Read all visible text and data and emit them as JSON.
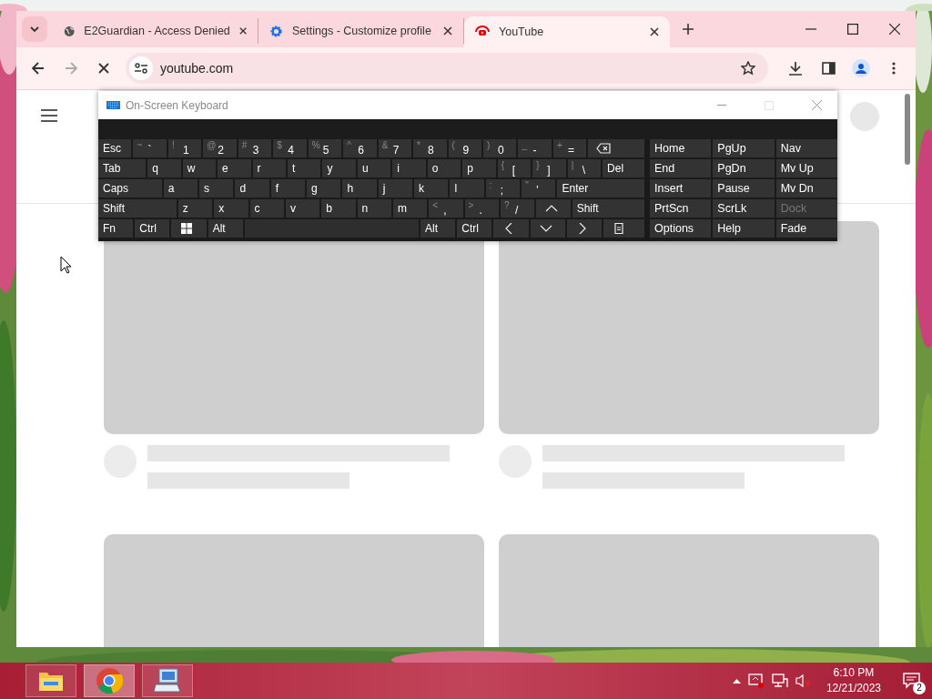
{
  "browser": {
    "tabs": [
      {
        "title": "E2Guardian - Access Denied",
        "selected": false,
        "kind": "globe"
      },
      {
        "title": "Settings - Customize profile",
        "selected": false,
        "kind": "gear"
      },
      {
        "title": "YouTube",
        "selected": true,
        "kind": "video"
      }
    ],
    "back": {
      "disabled": false
    },
    "forward": {
      "disabled": true
    },
    "loading": true,
    "address": "youtube.com"
  },
  "page": {
    "cards": [
      {
        "kind": "placeholder"
      },
      {
        "kind": "placeholder"
      },
      {
        "kind": "thumbnail"
      },
      {
        "kind": "thumbnail"
      }
    ]
  },
  "keyboard": {
    "title": "On-Screen Keyboard",
    "rows": [
      [
        {
          "label": "Esc"
        },
        {
          "shift": "~",
          "label": "`"
        },
        {
          "shift": "!",
          "label": "1"
        },
        {
          "shift": "@",
          "label": "2"
        },
        {
          "shift": "#",
          "label": "3"
        },
        {
          "shift": "$",
          "label": "4"
        },
        {
          "shift": "%",
          "label": "5"
        },
        {
          "shift": "^",
          "label": "6"
        },
        {
          "shift": "&",
          "label": "7"
        },
        {
          "shift": "*",
          "label": "8"
        },
        {
          "shift": "(",
          "label": "9"
        },
        {
          "shift": ")",
          "label": "0"
        },
        {
          "shift": "_",
          "label": "-"
        },
        {
          "shift": "+",
          "label": "="
        },
        {
          "kind": "backspace"
        }
      ],
      [
        {
          "label": "Tab"
        },
        {
          "label": "q"
        },
        {
          "label": "w"
        },
        {
          "label": "e"
        },
        {
          "label": "r"
        },
        {
          "label": "t"
        },
        {
          "label": "y"
        },
        {
          "label": "u"
        },
        {
          "label": "i"
        },
        {
          "label": "o"
        },
        {
          "label": "p"
        },
        {
          "shift": "{",
          "label": "["
        },
        {
          "shift": "}",
          "label": "]"
        },
        {
          "shift": "|",
          "label": "\\"
        },
        {
          "label": "Del"
        }
      ],
      [
        {
          "label": "Caps"
        },
        {
          "label": "a"
        },
        {
          "label": "s"
        },
        {
          "label": "d"
        },
        {
          "label": "f"
        },
        {
          "label": "g"
        },
        {
          "label": "h"
        },
        {
          "label": "j"
        },
        {
          "label": "k"
        },
        {
          "label": "l"
        },
        {
          "shift": ":",
          "label": ";"
        },
        {
          "shift": "\"",
          "label": "'"
        },
        {
          "label": "Enter"
        }
      ],
      [
        {
          "label": "Shift"
        },
        {
          "label": "z"
        },
        {
          "label": "x"
        },
        {
          "label": "c"
        },
        {
          "label": "v"
        },
        {
          "label": "b"
        },
        {
          "label": "n"
        },
        {
          "label": "m"
        },
        {
          "shift": "<",
          "label": ","
        },
        {
          "shift": ">",
          "label": "."
        },
        {
          "shift": "?",
          "label": "/"
        },
        {
          "kind": "up"
        },
        {
          "label": "Shift"
        }
      ],
      [
        {
          "label": "Fn"
        },
        {
          "label": "Ctrl"
        },
        {
          "kind": "windows"
        },
        {
          "label": "Alt"
        },
        {
          "kind": "space"
        },
        {
          "label": "Alt"
        },
        {
          "label": "Ctrl"
        },
        {
          "kind": "left"
        },
        {
          "kind": "down"
        },
        {
          "kind": "right"
        },
        {
          "kind": "menu"
        }
      ]
    ],
    "side": [
      [
        {
          "label": "Home",
          "disabled": false
        },
        {
          "label": "PgUp",
          "disabled": false
        },
        {
          "label": "Nav",
          "disabled": false
        }
      ],
      [
        {
          "label": "End",
          "disabled": false
        },
        {
          "label": "PgDn",
          "disabled": false
        },
        {
          "label": "Mv Up",
          "disabled": false
        }
      ],
      [
        {
          "label": "Insert",
          "disabled": false
        },
        {
          "label": "Pause",
          "disabled": false
        },
        {
          "label": "Mv Dn",
          "disabled": false
        }
      ],
      [
        {
          "label": "PrtScn",
          "disabled": false
        },
        {
          "label": "ScrLk",
          "disabled": false
        },
        {
          "label": "Dock",
          "disabled": true
        }
      ],
      [
        {
          "label": "Options",
          "disabled": false
        },
        {
          "label": "Help",
          "disabled": false
        },
        {
          "label": "Fade",
          "disabled": false
        }
      ]
    ]
  },
  "taskbar": {
    "apps": [
      {
        "kind": "folder",
        "selected": false
      },
      {
        "kind": "chrome",
        "selected": true
      },
      {
        "kind": "keyboard",
        "selected": false
      }
    ],
    "time": "6:10 PM",
    "date": "12/21/2023",
    "notifications": "2"
  }
}
